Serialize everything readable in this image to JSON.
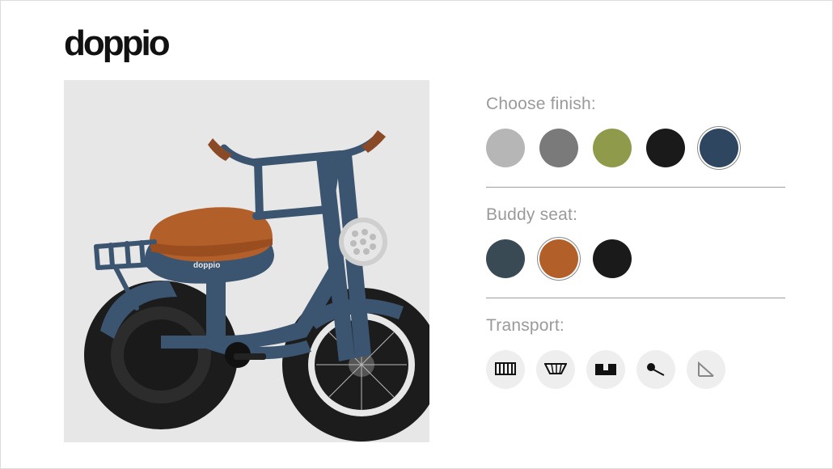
{
  "brand": "doppio",
  "product_preview": {
    "alt": "Doppio electric bike in navy blue with brown seat",
    "frame_color": "#3b546f",
    "seat_color": "#b35f2a",
    "tire_color": "#1c1c1c",
    "grip_color": "#8a4a28"
  },
  "finish": {
    "label": "Choose finish:",
    "options": [
      {
        "name": "light-grey",
        "hex": "#b6b6b6",
        "selected": false
      },
      {
        "name": "grey",
        "hex": "#7a7a7a",
        "selected": false
      },
      {
        "name": "olive",
        "hex": "#8f9b4b",
        "selected": false
      },
      {
        "name": "black",
        "hex": "#1a1a1a",
        "selected": false
      },
      {
        "name": "navy",
        "hex": "#2f4660",
        "selected": true
      }
    ]
  },
  "buddy_seat": {
    "label": "Buddy seat:",
    "options": [
      {
        "name": "slate",
        "hex": "#3a4a55",
        "selected": false
      },
      {
        "name": "brown",
        "hex": "#b35f2a",
        "selected": true
      },
      {
        "name": "black",
        "hex": "#1a1a1a",
        "selected": false
      }
    ]
  },
  "transport": {
    "label": "Transport:",
    "options": [
      {
        "name": "front-rack"
      },
      {
        "name": "basket"
      },
      {
        "name": "pannier"
      },
      {
        "name": "mirror"
      },
      {
        "name": "kickstand"
      }
    ]
  }
}
